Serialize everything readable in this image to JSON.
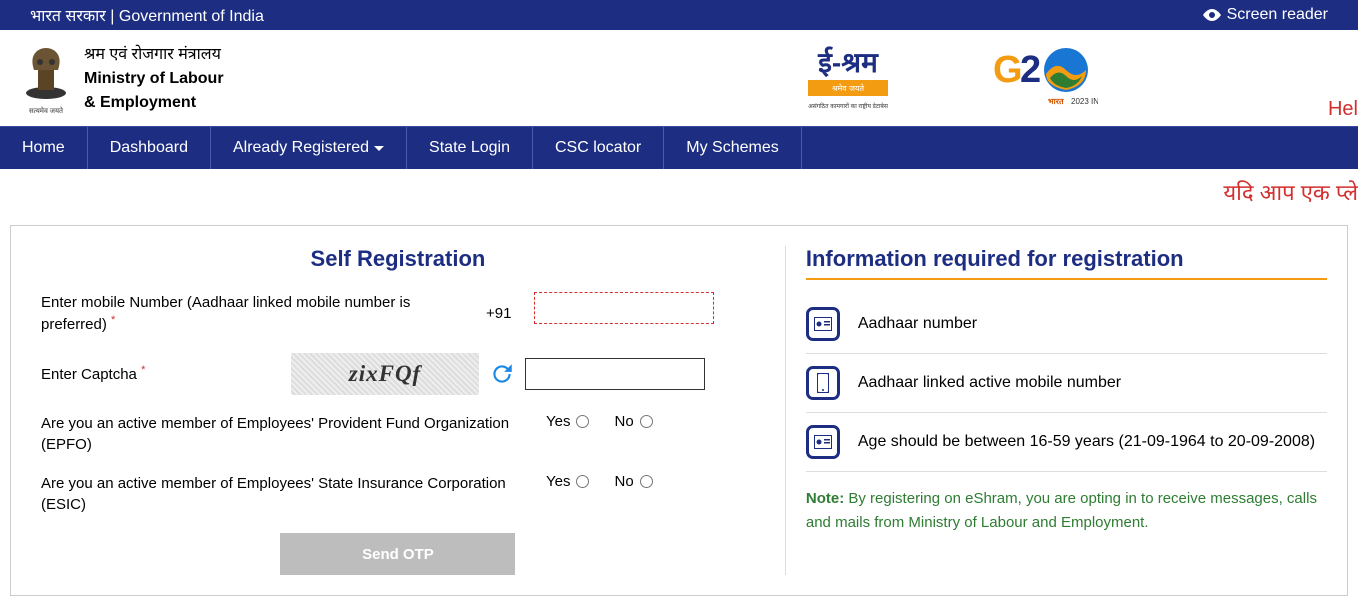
{
  "gov_bar": {
    "text": "भारत सरकार | Government of India",
    "screen_reader": "Screen reader"
  },
  "ministry": {
    "hindi": "श्रम एवं रोजगार मंत्रालय",
    "en_line1": "Ministry of Labour",
    "en_line2": "& Employment"
  },
  "help_link": "Hel",
  "nav": {
    "home": "Home",
    "dashboard": "Dashboard",
    "already_registered": "Already Registered",
    "state_login": "State Login",
    "csc_locator": "CSC locator",
    "my_schemes": "My Schemes"
  },
  "marquee": "यदि आप एक प्ले",
  "form": {
    "title": "Self Registration",
    "mobile_label": "Enter mobile Number (Aadhaar linked mobile number is preferred)",
    "mobile_prefix": "+91",
    "captcha_label": "Enter Captcha",
    "captcha_value": "zixFQf",
    "epfo_label": "Are you an active member of Employees' Provident Fund Organization (EPFO)",
    "esic_label": "Are you an active member of Employees' State Insurance Corporation (ESIC)",
    "yes": "Yes",
    "no": "No",
    "send_otp": "Send OTP"
  },
  "info": {
    "title": "Information required for registration",
    "aadhaar": "Aadhaar number",
    "mobile": "Aadhaar linked active mobile number",
    "age": "Age should be between 16-59 years (21-09-1964 to 20-09-2008)",
    "note_label": "Note:",
    "note_text": " By registering on eShram, you are opting in to receive messages, calls and mails from Ministry of Labour and Employment."
  }
}
